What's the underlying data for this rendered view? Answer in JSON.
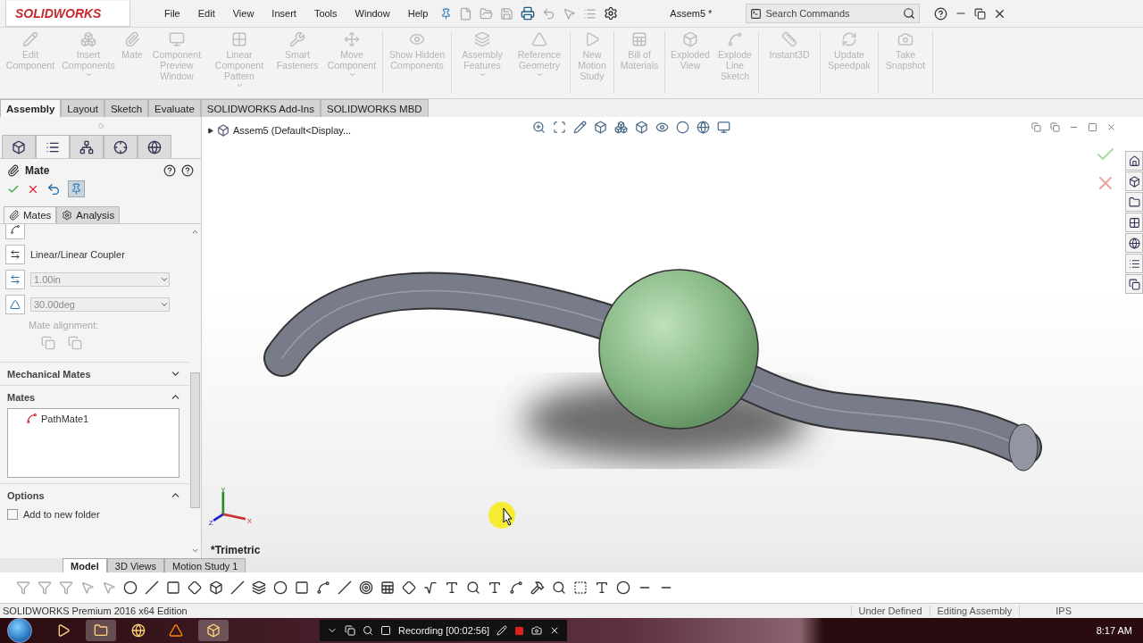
{
  "app": {
    "logo": "SOLIDWORKS",
    "menu": [
      "File",
      "Edit",
      "View",
      "Insert",
      "Tools",
      "Window",
      "Help"
    ],
    "title": "Assem5 *",
    "search": {
      "placeholder": "Search Commands"
    }
  },
  "ribbon": {
    "groups": [
      [
        {
          "label": "Edit Component",
          "dropdown": false
        },
        {
          "label": "Insert Components",
          "dropdown": true
        },
        {
          "label": "Mate",
          "dropdown": false
        },
        {
          "label": "Component Preview Window",
          "dropdown": false
        },
        {
          "label": "Linear Component Pattern",
          "dropdown": true
        },
        {
          "label": "Smart Fasteners",
          "dropdown": false
        },
        {
          "label": "Move Component",
          "dropdown": true
        }
      ],
      [
        {
          "label": "Show Hidden Components",
          "dropdown": false
        }
      ],
      [
        {
          "label": "Assembly Features",
          "dropdown": true
        },
        {
          "label": "Reference Geometry",
          "dropdown": true
        }
      ],
      [
        {
          "label": "New Motion Study",
          "dropdown": false
        }
      ],
      [
        {
          "label": "Bill of Materials",
          "dropdown": false
        }
      ],
      [
        {
          "label": "Exploded View",
          "dropdown": false
        },
        {
          "label": "Explode Line Sketch",
          "dropdown": false
        }
      ],
      [
        {
          "label": "Instant3D",
          "dropdown": false
        }
      ],
      [
        {
          "label": "Update Speedpak",
          "dropdown": false
        }
      ],
      [
        {
          "label": "Take Snapshot",
          "dropdown": false
        }
      ]
    ]
  },
  "command_tabs": [
    {
      "label": "Assembly",
      "selected": true
    },
    {
      "label": "Layout",
      "selected": false
    },
    {
      "label": "Sketch",
      "selected": false
    },
    {
      "label": "Evaluate",
      "selected": false
    },
    {
      "label": "SOLIDWORKS Add-Ins",
      "selected": false
    },
    {
      "label": "SOLIDWORKS MBD",
      "selected": false
    }
  ],
  "property_manager": {
    "tabs": [
      {
        "kind": "feature-tree",
        "selected": false
      },
      {
        "kind": "property",
        "selected": true
      },
      {
        "kind": "config",
        "selected": false
      },
      {
        "kind": "dimxpert",
        "selected": false
      },
      {
        "kind": "display",
        "selected": false
      }
    ],
    "title": "Mate",
    "subtabs": [
      {
        "label": "Mates",
        "selected": true
      },
      {
        "label": "Analysis",
        "selected": false
      }
    ],
    "mate_type": "Linear/Linear Coupler",
    "fields": [
      {
        "kind": "distance",
        "value": "1.00in"
      },
      {
        "kind": "angle",
        "value": "30.00deg"
      }
    ],
    "alignment_label": "Mate alignment:",
    "sections": [
      {
        "title": "Mechanical Mates",
        "expanded": false
      },
      {
        "title": "Mates",
        "expanded": true,
        "items": [
          "PathMate1"
        ]
      },
      {
        "title": "Options",
        "expanded": true,
        "checkboxes": [
          {
            "label": "Add to new folder",
            "checked": false
          }
        ]
      }
    ]
  },
  "viewport": {
    "tree_root": "Assem5  (Default<Display...",
    "view_label": "*Trimetric",
    "axes": [
      "X",
      "Y",
      "Z"
    ]
  },
  "bottom_tabs": [
    {
      "label": "Model",
      "selected": true
    },
    {
      "label": "3D Views",
      "selected": false
    },
    {
      "label": "Motion Study 1",
      "selected": false
    }
  ],
  "status_bar": {
    "edition": "SOLIDWORKS Premium 2016 x64 Edition",
    "fields": [
      "Under Defined",
      "Editing Assembly",
      "IPS"
    ]
  },
  "taskbar": {
    "recording": "Recording [00:02:56]",
    "clock": "8:17 AM"
  }
}
